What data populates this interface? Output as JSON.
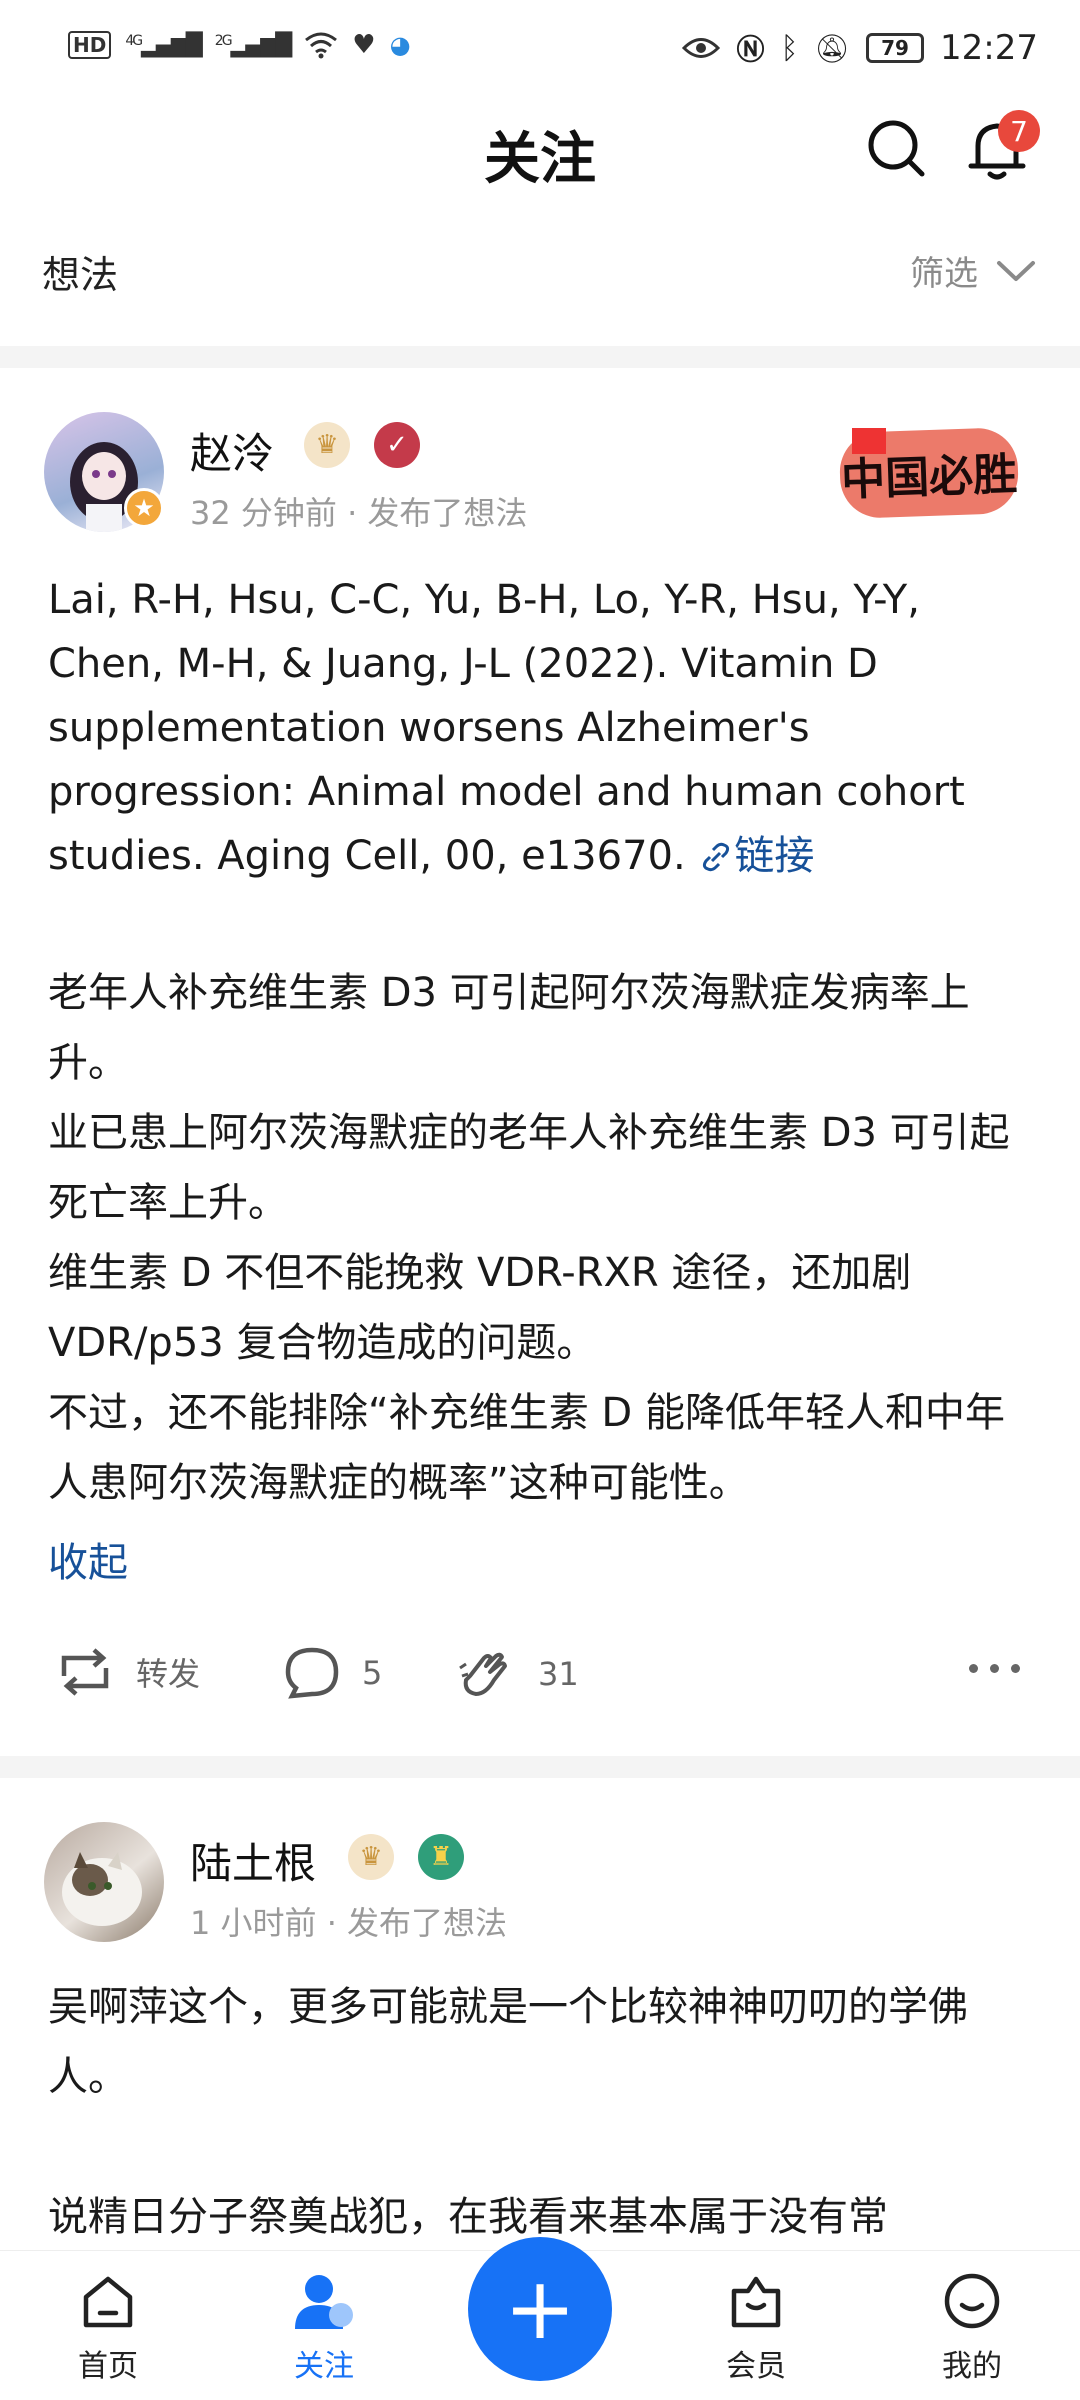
{
  "status_bar": {
    "left_tags": [
      "HD",
      "4G",
      "2G"
    ],
    "battery": "79",
    "time": "12:27"
  },
  "header": {
    "title": "关注",
    "notification_count": "7"
  },
  "filter": {
    "section_title": "想法",
    "filter_label": "筛选"
  },
  "posts": [
    {
      "author": "赵泠",
      "meta": "32 分钟前 · 发布了想法",
      "stamp_text": "中国必胜",
      "paragraphs": [
        "Lai, R-H, Hsu, C-C, Yu, B-H, Lo, Y-R, Hsu, Y-Y, Chen, M-H, & Juang, J-L (2022). Vitamin D supplementation worsens Alzheimer's progression: Animal model and human cohort studies. Aging Cell, 00, e13670."
      ],
      "link_label": "链接",
      "paragraphs2": [
        "老年人补充维生素 D3 可引起阿尔茨海默症发病率上升。",
        "业已患上阿尔茨海默症的老年人补充维生素 D3 可引起死亡率上升。",
        "维生素 D 不但不能挽救 VDR-RXR 途径，还加剧 VDR/p53 复合物造成的问题。",
        "不过，还不能排除“补充维生素 D 能降低年轻人和中年人患阿尔茨海默症的概率”这种可能性。"
      ],
      "collapse_label": "收起",
      "repost_label": "转发",
      "comment_count": "5",
      "applause_count": "31"
    },
    {
      "author": "陆土根",
      "meta": "1 小时前 · 发布了想法",
      "paragraphs": [
        "吴啊萍这个，更多可能就是一个比较神神叨叨的学佛人。",
        "说精日分子祭奠战犯，在我看来基本属于没有常"
      ]
    }
  ],
  "bottom_nav": [
    {
      "label": "首页",
      "icon": "home-icon"
    },
    {
      "label": "关注",
      "icon": "follow-icon"
    },
    {
      "label": "会员",
      "icon": "vip-icon"
    },
    {
      "label": "我的",
      "icon": "profile-icon"
    }
  ],
  "colors": {
    "accent": "#1772f6",
    "link": "#175199",
    "badge": "#e8483c"
  }
}
